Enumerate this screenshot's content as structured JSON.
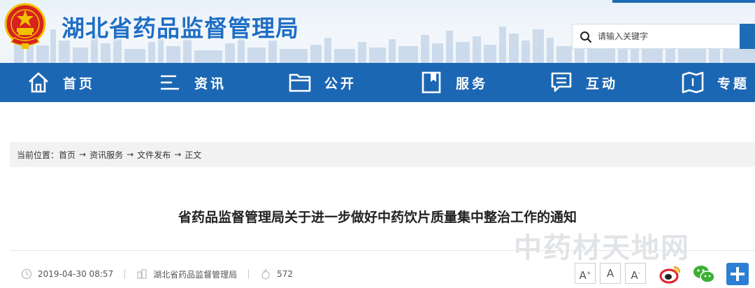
{
  "header": {
    "site_title": "湖北省药品监督管理局",
    "search": {
      "placeholder": "请输入关键字"
    }
  },
  "nav": {
    "items": [
      {
        "label": "首页",
        "icon": "home-icon"
      },
      {
        "label": "资讯",
        "icon": "list-icon"
      },
      {
        "label": "公开",
        "icon": "folder-icon"
      },
      {
        "label": "服务",
        "icon": "bookmark-icon"
      },
      {
        "label": "互动",
        "icon": "chat-icon"
      },
      {
        "label": "专题",
        "icon": "book-icon"
      }
    ]
  },
  "breadcrumb": {
    "prefix": "当前位置：",
    "items": [
      "首页",
      "资讯服务",
      "文件发布",
      "正文"
    ],
    "separator": "→"
  },
  "article": {
    "title": "省药品监督管理局关于进一步做好中药饮片质量集中整治工作的通知",
    "date": "2019-04-30 08:57",
    "source": "湖北省药品监督管理局",
    "views": "572"
  },
  "tools": {
    "font_increase": "A",
    "font_reset": "A",
    "font_decrease": "A",
    "share": [
      "weibo-icon",
      "wechat-icon",
      "plus-icon"
    ]
  },
  "watermark": "中药材天地网",
  "colors": {
    "brand_blue": "#1c67b3",
    "title_blue": "#1f6fc4",
    "emblem_red": "#d6231f",
    "emblem_gold": "#f2c200"
  }
}
